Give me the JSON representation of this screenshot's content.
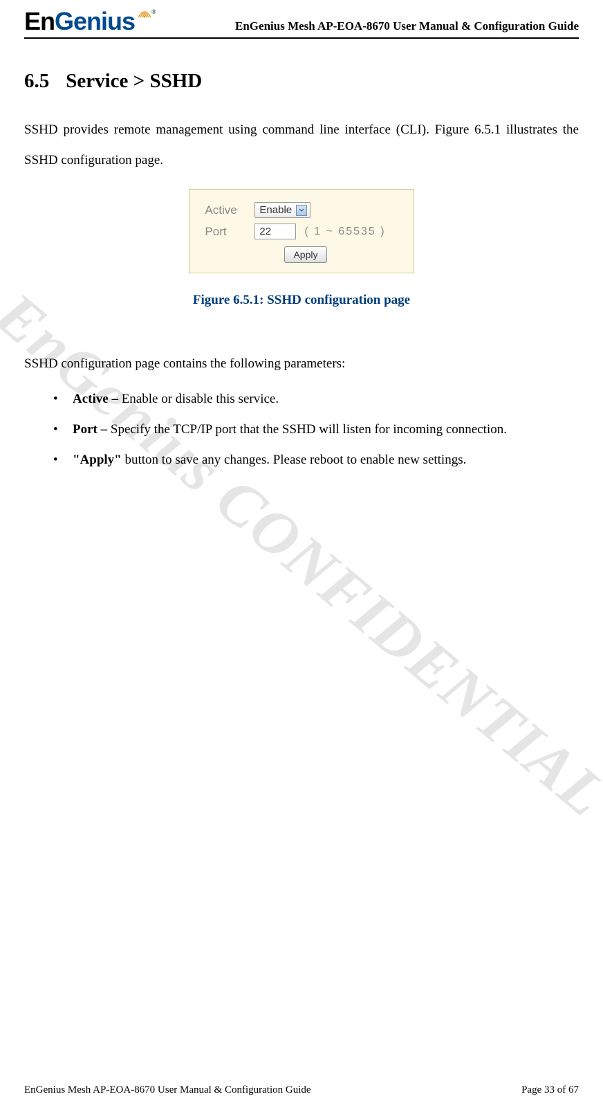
{
  "header": {
    "logo_text_en": "En",
    "logo_text_genius": "Genius",
    "doc_title": "EnGenius Mesh AP-EOA-8670 User Manual & Configuration Guide"
  },
  "watermark": "EnGenius CONFIDENTIAL",
  "section": {
    "number": "6.5",
    "title": "Service > SSHD"
  },
  "intro_text": "SSHD provides remote management using command line interface (CLI). Figure 6.5.1 illustrates the SSHD configuration page.",
  "config_panel": {
    "active_label": "Active",
    "active_value": "Enable",
    "port_label": "Port",
    "port_value": "22",
    "port_range": "( 1 ~ 65535 )",
    "apply_label": "Apply"
  },
  "figure_caption": "Figure 6.5.1: SSHD configuration page",
  "params_intro": "SSHD configuration page contains the following parameters:",
  "params": [
    {
      "term": "Active – ",
      "desc": "Enable or disable this service."
    },
    {
      "term": "Port – ",
      "desc": "Specify the TCP/IP port that the SSHD will listen for incoming connection."
    },
    {
      "term": "\"Apply\" ",
      "desc": "button to save any changes. Please reboot to enable new settings."
    }
  ],
  "footer": {
    "left": "EnGenius Mesh AP-EOA-8670 User Manual & Configuration Guide",
    "right": "Page 33 of 67"
  }
}
